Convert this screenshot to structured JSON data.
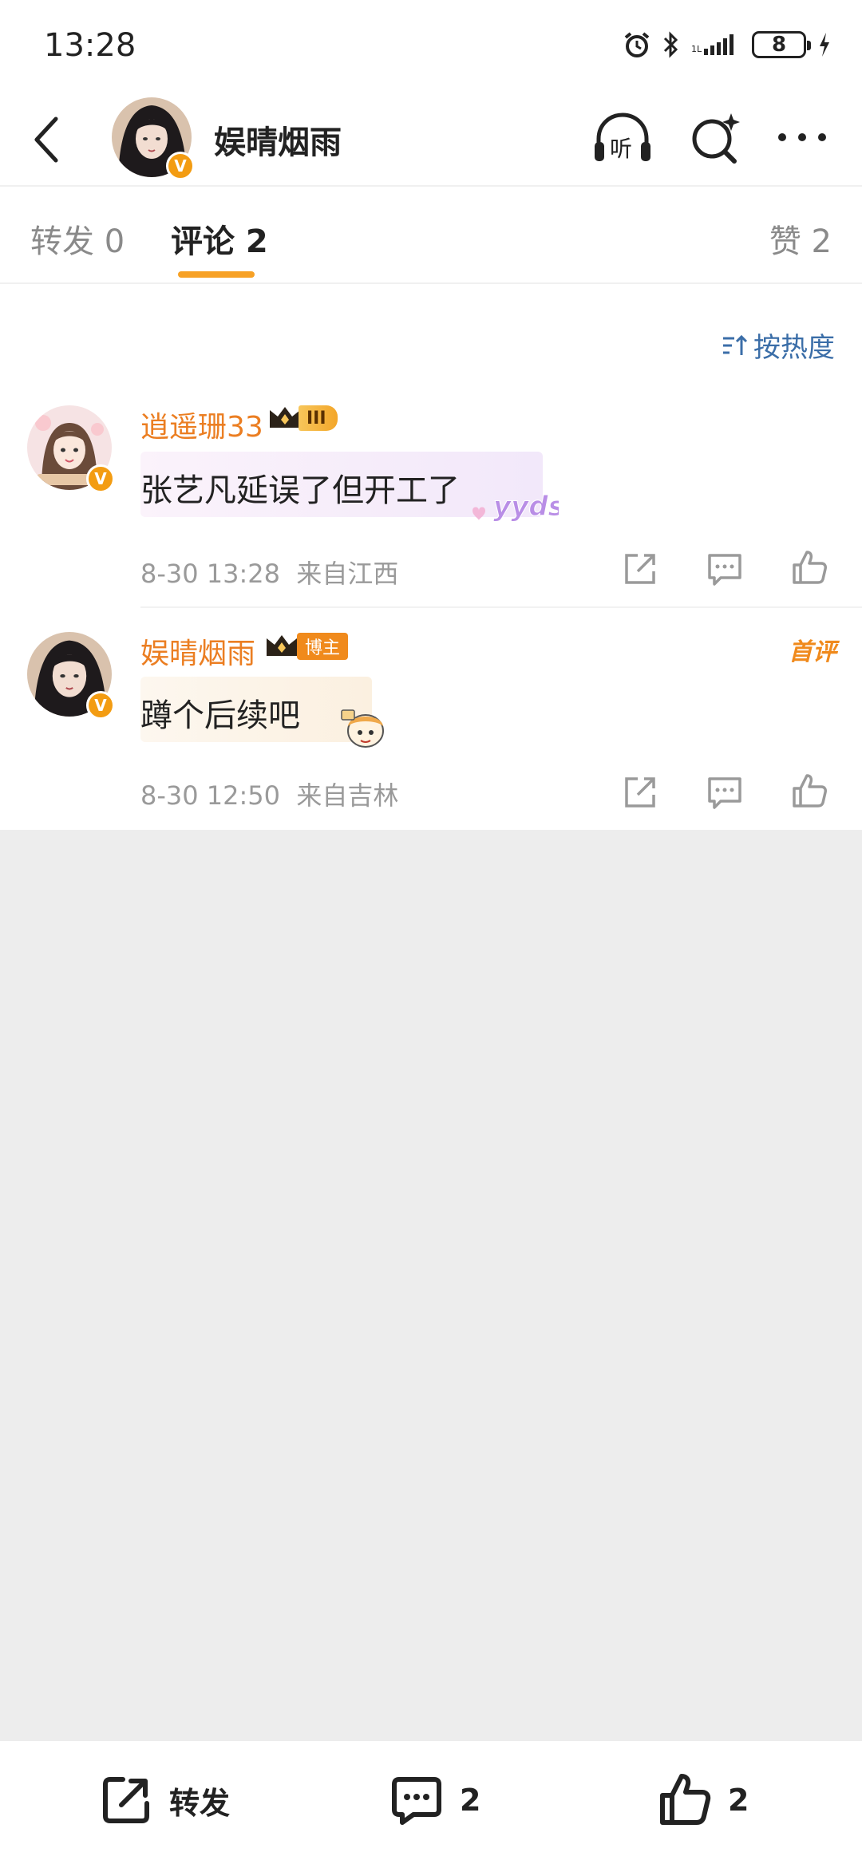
{
  "status_bar": {
    "time": "13:28",
    "battery": "8"
  },
  "header": {
    "name": "娱晴烟雨"
  },
  "tabs": {
    "reposts": "转发 0",
    "comments": "评论 2",
    "likes": "赞 2"
  },
  "sort": {
    "label": "按热度"
  },
  "comments": [
    {
      "user": "逍遥珊33",
      "level_badge": "III",
      "text": "张艺凡延误了但开工了",
      "sticker_text": "yyds",
      "time": "8-30 13:28",
      "location": "来自江西"
    },
    {
      "user": "娱晴烟雨",
      "role_badge": "博主",
      "tag": "首评",
      "text": "蹲个后续吧",
      "time": "8-30 12:50",
      "location": "来自吉林"
    }
  ],
  "bottom_bar": {
    "repost_label": "转发",
    "comment_count": "2",
    "like_count": "2"
  },
  "colors": {
    "accent": "#f7a125",
    "username": "#eb7e22",
    "sort_link": "#3b6ea8",
    "verified": "#f39c12"
  },
  "icons": [
    "back-arrow-icon",
    "listen-icon",
    "search-icon",
    "more-icon",
    "sort-icon",
    "crown-icon",
    "share-icon",
    "comment-icon",
    "like-icon",
    "alarm-icon",
    "bluetooth-icon",
    "signal-icon",
    "charging-icon"
  ]
}
